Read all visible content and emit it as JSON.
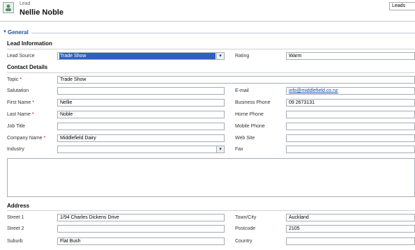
{
  "header": {
    "entity_type": "Lead",
    "record_name": "Nellie Noble",
    "entity_box": "Leads"
  },
  "section": {
    "title": "General"
  },
  "lead_information": {
    "title": "Lead Information",
    "lead_source_label": "Lead Source",
    "lead_source_value": "Trade Show",
    "rating_label": "Rating",
    "rating_value": "Warm"
  },
  "contact_details": {
    "title": "Contact Details",
    "topic_label": "Topic",
    "topic_value": "Trade Show",
    "salutation_label": "Salutation",
    "salutation_value": "",
    "first_name_label": "First Name",
    "first_name_value": "Nellie",
    "last_name_label": "Last Name",
    "last_name_value": "Noble",
    "job_title_label": "Job Title",
    "job_title_value": "",
    "company_name_label": "Company Name",
    "company_name_value": "Middlefield Dairy",
    "industry_label": "Industry",
    "industry_value": "",
    "email_label": "E-mail",
    "email_value": "info@middlefield.co.nz",
    "business_phone_label": "Business Phone",
    "business_phone_value": "09 2673131",
    "home_phone_label": "Home Phone",
    "home_phone_value": "",
    "mobile_phone_label": "Mobile Phone",
    "mobile_phone_value": "",
    "web_site_label": "Web Site",
    "web_site_value": "",
    "fax_label": "Fax",
    "fax_value": "",
    "required_marker": "*"
  },
  "address": {
    "title": "Address",
    "street1_label": "Street 1",
    "street1_value": "1/94 Charles Dickens Drive",
    "street2_label": "Street 2",
    "street2_value": "",
    "suburb_label": "Suburb",
    "suburb_value": "Flat Bush",
    "town_label": "Town/City",
    "town_value": "Auckland",
    "postcode_label": "Postcode",
    "postcode_value": "2105",
    "country_label": "Country",
    "country_value": ""
  },
  "icons": {
    "lead": "lead-icon",
    "dropdown": "chevron-down-icon",
    "collapse": "triangle-down-icon"
  },
  "colors": {
    "section_title": "#1f4e9a",
    "required": "#cc0000",
    "selection": "#2f5fbf",
    "link": "#0645ad"
  }
}
